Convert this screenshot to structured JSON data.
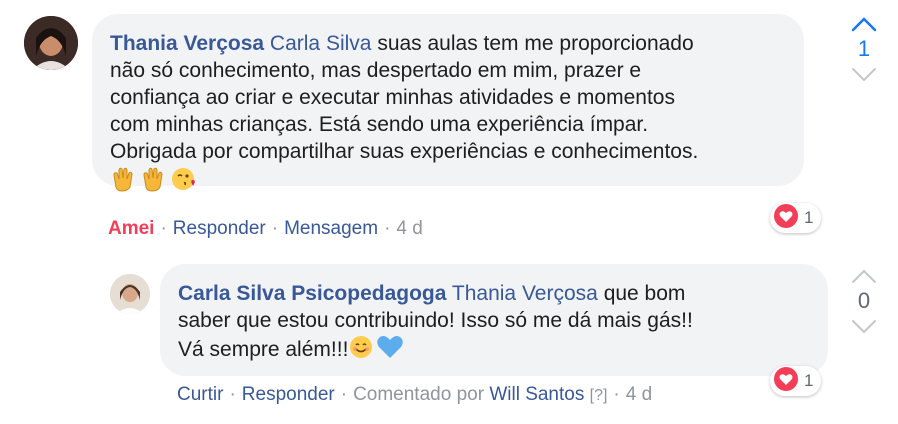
{
  "comment": {
    "author": "Thania Verçosa",
    "mention": "Carla Silva",
    "lines": [
      "suas aulas tem me proporcionado",
      "não só conhecimento, mas despertado em mim, prazer e",
      "confiança ao criar e executar minhas atividades e momentos",
      "com minhas crianças. Está sendo uma experiência ímpar.",
      "Obrigada por compartilhar suas experiências e conhecimentos."
    ],
    "emojis": [
      "clapping-hands-emoji",
      "clapping-hands-emoji",
      "face-blowing-kiss-emoji"
    ],
    "actions": {
      "reaction_label": "Amei",
      "reply_label": "Responder",
      "message_label": "Mensagem",
      "time": "4 d"
    },
    "reaction_count": "1",
    "vote_count": "1",
    "accent_color": "#1877f2"
  },
  "reply": {
    "author": "Carla Silva Psicopedagoga",
    "mention": "Thania Verçosa",
    "lines": [
      "que bom",
      "saber que estou contribuindo! Isso só me dá mais gás!!",
      "Vá sempre além!!!"
    ],
    "emojis": [
      "smiling-face-emoji",
      "blue-heart-emoji"
    ],
    "actions": {
      "like_label": "Curtir",
      "reply_label": "Responder",
      "commented_by_label": "Comentado por",
      "commented_by_name": "Will Santos",
      "help_marker": "[?]",
      "time": "4 d"
    },
    "reaction_count": "1",
    "vote_count": "0"
  },
  "colors": {
    "link": "#385898",
    "love": "#f33e58",
    "muted": "#90949c",
    "bubble": "#f2f3f5"
  }
}
